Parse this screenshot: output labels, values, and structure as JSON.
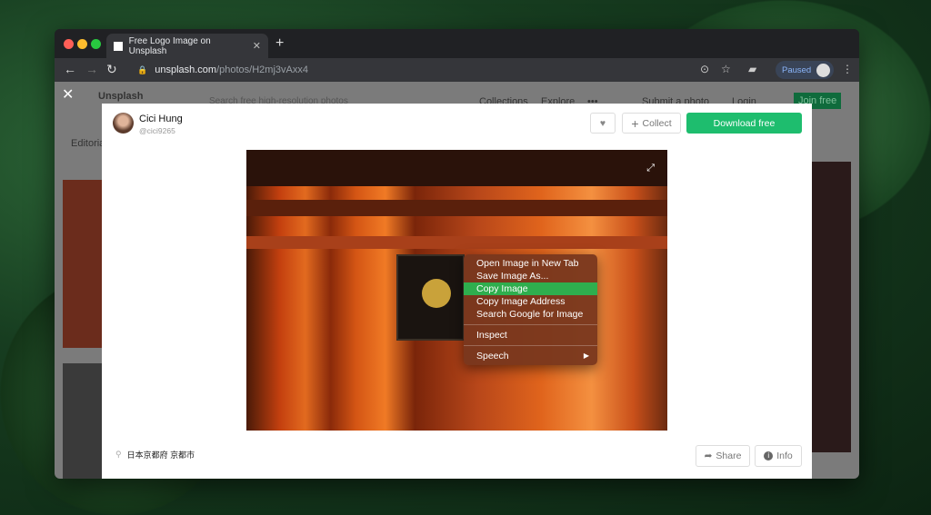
{
  "browser": {
    "tab_title": "Free Logo Image on Unsplash",
    "url_domain": "unsplash.com",
    "url_path": "/photos/H2mj3vAxx4",
    "profile_status": "Paused"
  },
  "background_page": {
    "brand": "Unsplash",
    "search_placeholder": "Search free high-resolution photos",
    "nav": [
      "Collections",
      "Explore",
      "•••"
    ],
    "submit": "Submit a photo",
    "login": "Login",
    "join": "Join free",
    "tab": "Editorial"
  },
  "modal": {
    "author_name": "Cici Hung",
    "author_handle": "@cici9265",
    "collect_label": "Collect",
    "download_label": "Download free",
    "location": "日本京都府 京都市",
    "share_label": "Share",
    "info_label": "Info"
  },
  "context_menu": {
    "items": [
      "Open Image in New Tab",
      "Save Image As...",
      "Copy Image",
      "Copy Image Address",
      "Search Google for Image",
      "Inspect",
      "Speech"
    ],
    "selected": "Copy Image"
  },
  "colors": {
    "accent": "#1ebd6e",
    "menu_highlight": "#2fae4e"
  }
}
